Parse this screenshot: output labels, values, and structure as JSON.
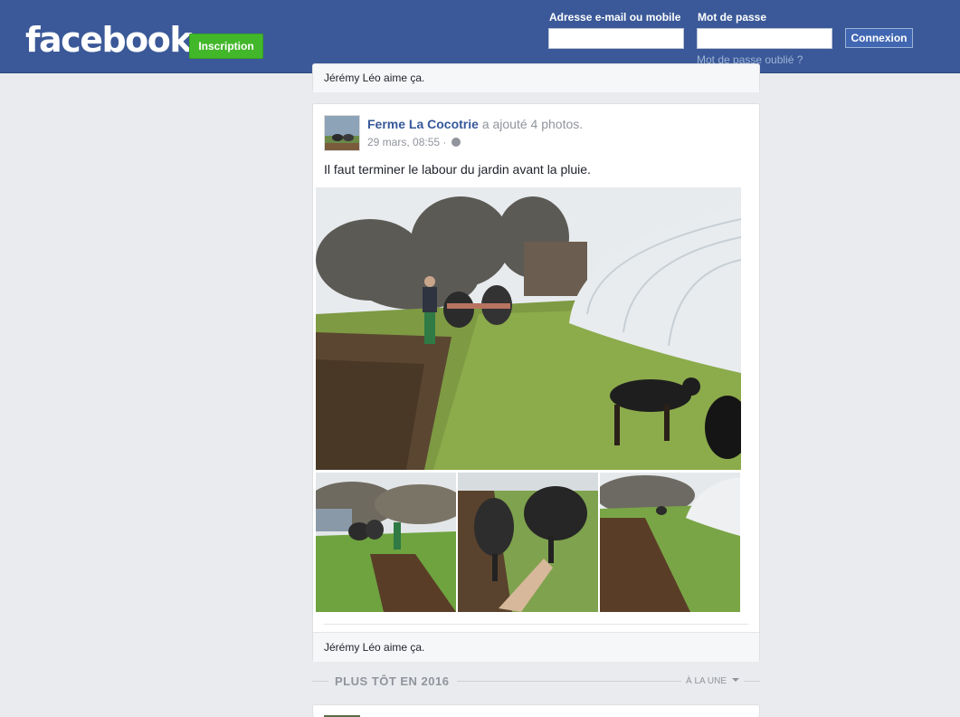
{
  "header": {
    "logo": "facebook",
    "signup_label": "Inscription",
    "email_label": "Adresse e-mail ou mobile",
    "email_value": "",
    "password_label": "Mot de passe",
    "password_value": "",
    "login_label": "Connexion",
    "forgot_label": "Mot de passe oublié ?"
  },
  "prev_post": {
    "likes_text": "Jérémy Léo aime ça."
  },
  "post": {
    "author": "Ferme La Cocotrie",
    "action": "a ajouté 4 photos.",
    "timestamp": "29 mars, 08:55 ·",
    "text": "Il faut terminer le labour du jardin avant la pluie.",
    "likes_text": "Jérémy Léo aime ça."
  },
  "section": {
    "title": "PLUS TÔT EN 2016",
    "sort_label": "À LA UNE"
  },
  "colors": {
    "brand": "#3b5998",
    "signup": "#42b72a",
    "link": "#365899"
  },
  "icons": [
    "globe-icon",
    "dropdown-caret-icon"
  ]
}
